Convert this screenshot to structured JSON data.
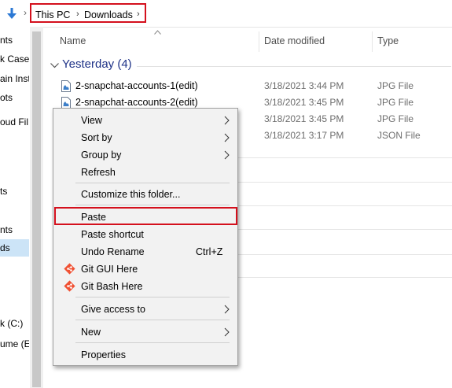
{
  "addressbar": {
    "crumbs": [
      "This PC",
      "Downloads"
    ]
  },
  "sidebar": {
    "items": [
      {
        "label": "nts"
      },
      {
        "label": "k Case S"
      },
      {
        "label": "ain Inst"
      },
      {
        "label": "ots"
      },
      {
        "label": "oud Fil"
      },
      {
        "label": "ts"
      },
      {
        "label": "nts"
      },
      {
        "label": "ds",
        "selected": true
      },
      {
        "label": "k (C:)"
      },
      {
        "label": "ume (E:)"
      }
    ]
  },
  "columns": {
    "name": "Name",
    "date": "Date modified",
    "type": "Type"
  },
  "group": {
    "label": "Yesterday (4)"
  },
  "files": [
    {
      "name": "2-snapchat-accounts-1(edit)",
      "date": "3/18/2021 3:44 PM",
      "type": "JPG File"
    },
    {
      "name": "2-snapchat-accounts-2(edit)",
      "date": "3/18/2021 3:45 PM",
      "type": "JPG File"
    },
    {
      "name": "",
      "date": "3/18/2021 3:45 PM",
      "type": "JPG File"
    },
    {
      "name": "",
      "date": "3/18/2021 3:17 PM",
      "type": "JSON File"
    }
  ],
  "context_menu": {
    "view": "View",
    "sort_by": "Sort by",
    "group_by": "Group by",
    "refresh": "Refresh",
    "customize": "Customize this folder...",
    "paste": "Paste",
    "paste_shortcut": "Paste shortcut",
    "undo_rename": "Undo Rename",
    "undo_shortcut": "Ctrl+Z",
    "git_gui": "Git GUI Here",
    "git_bash": "Git Bash Here",
    "give_access": "Give access to",
    "new": "New",
    "properties": "Properties"
  },
  "colors": {
    "highlight_box": "#d4101d",
    "group_header": "#1e3287",
    "selected": "#cce4f7"
  }
}
